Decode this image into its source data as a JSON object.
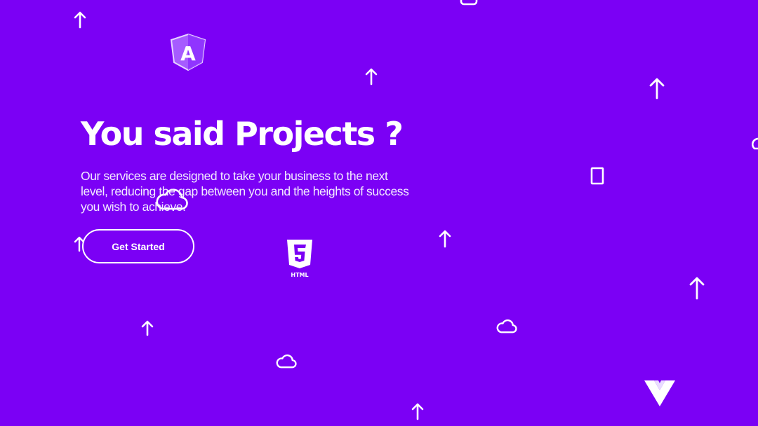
{
  "hero": {
    "title": "You said Projects ?",
    "description": "Our services are designed to take your business to the next level, reducing the gap between you and the heights of success you wish to achieve.",
    "cta_label": "Get Started"
  },
  "colors": {
    "background": "#7b00f5",
    "foreground": "#ffffff"
  },
  "icons": {
    "html5_label": "HTML",
    "angular_letter": "A",
    "floating": [
      "arrow-up-icon",
      "cloud-icon",
      "tablet-icon",
      "angular-icon",
      "html5-icon",
      "vue-icon"
    ]
  }
}
